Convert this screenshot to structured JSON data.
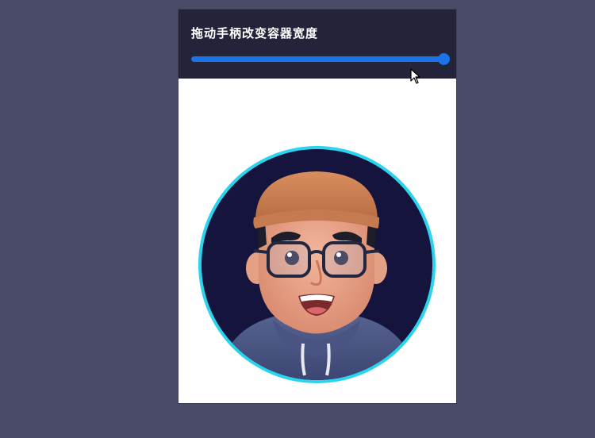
{
  "panel": {
    "title": "拖动手柄改变容器宽度"
  },
  "slider": {
    "value_percent": 100
  },
  "avatar": {
    "ring_color": "#2ad3ee",
    "background_color": "#15143d"
  },
  "cursor": {
    "icon": "arrow-cursor-icon"
  }
}
